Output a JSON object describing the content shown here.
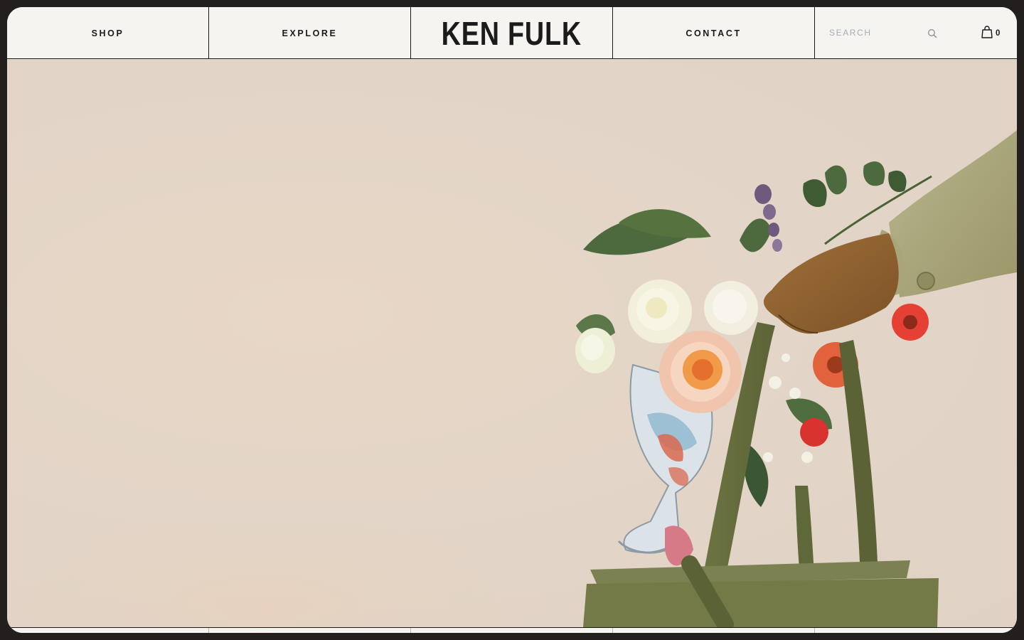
{
  "nav": {
    "shop_label": "SHOP",
    "explore_label": "EXPLORE",
    "brand": "KEN FULK",
    "contact_label": "CONTACT",
    "search_placeholder": "SEARCH",
    "search_icon": "search-icon",
    "cart_icon": "shopping-bag-icon",
    "cart_count": "0"
  },
  "colors": {
    "ink": "#1b1b1b",
    "nav_background": "#f5f4f1",
    "hero_background": "#e3d5c7",
    "outer_background": "#231f1e",
    "bag_green": "#6f7a46"
  }
}
